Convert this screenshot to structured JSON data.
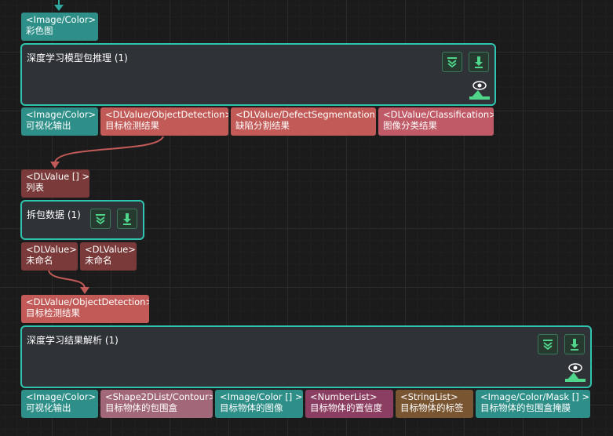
{
  "node1": {
    "input": {
      "type": "<Image/Color>",
      "name": "彩色图"
    },
    "title": "深度学习模型包推理 (1)",
    "outputs": [
      {
        "type": "<Image/Color>",
        "name": "可视化输出"
      },
      {
        "type": "<DLValue/ObjectDetection>",
        "name": "目标检测结果"
      },
      {
        "type": "<DLValue/DefectSegmentation>",
        "name": "缺陷分割结果"
      },
      {
        "type": "<DLValue/Classification>",
        "name": "图像分类结果"
      }
    ]
  },
  "node2": {
    "input": {
      "type": "<DLValue [] >",
      "name": "列表"
    },
    "title": "拆包数据 (1)",
    "outputs": [
      {
        "type": "<DLValue>",
        "name": "未命名"
      },
      {
        "type": "<DLValue>",
        "name": "未命名"
      }
    ]
  },
  "node3": {
    "input": {
      "type": "<DLValue/ObjectDetection>",
      "name": "目标检测结果"
    },
    "title": "深度学习结果解析 (1)",
    "outputs": [
      {
        "type": "<Image/Color>",
        "name": "可视化输出"
      },
      {
        "type": "<Shape2DList/Contour>",
        "name": "目标物体的包围盒"
      },
      {
        "type": "<Image/Color [] >",
        "name": "目标物体的图像"
      },
      {
        "type": "<NumberList>",
        "name": "目标物体的置信度"
      },
      {
        "type": "<StringList>",
        "name": "目标物体的标签"
      },
      {
        "type": "<Image/Color/Mask [] >",
        "name": "目标物体的包围盒掩膜"
      }
    ]
  },
  "colors": {
    "accent": "#2fc4b0",
    "wire": "#c25a57",
    "teal": "#2e8f88"
  },
  "icons": [
    "collapse-icon",
    "download-icon",
    "eye-preview-icon"
  ]
}
